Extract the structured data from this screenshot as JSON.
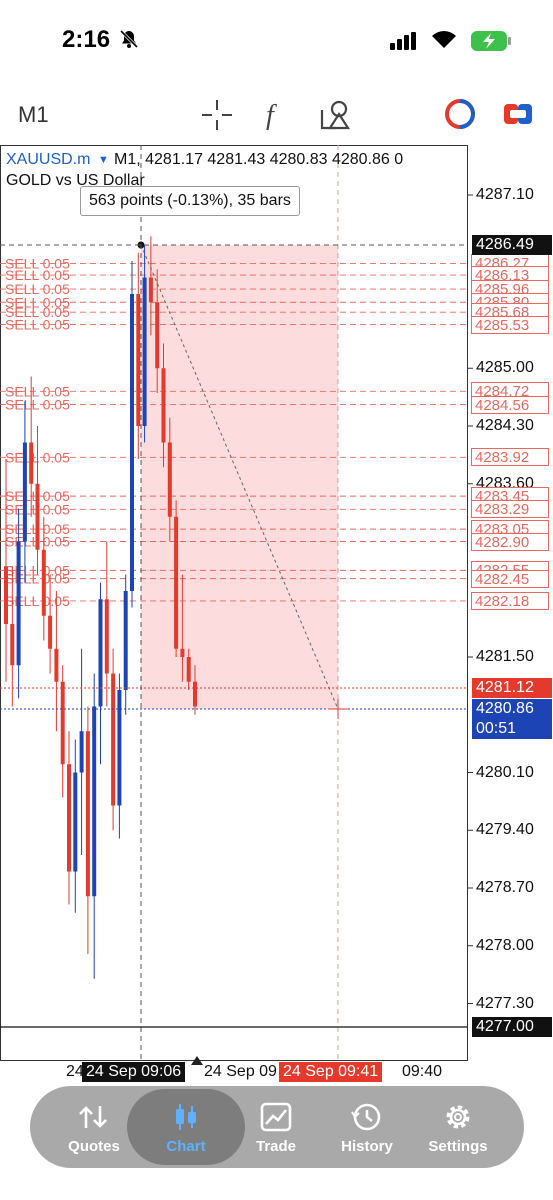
{
  "status_bar": {
    "time": "2:16"
  },
  "toolbar": {
    "timeframe": "M1"
  },
  "chart_header": {
    "symbol": "XAUUSD.m",
    "timeframe": "M1,",
    "ohlc": "4281.17 4281.43 4280.83 4280.86 0",
    "subtitle": "GOLD vs US Dollar",
    "measure_tooltip": "563 points (-0.13%), 35 bars"
  },
  "price_axis": {
    "ticks": [
      "4287.10",
      "4285.00",
      "4284.30",
      "4283.60",
      "4281.50",
      "4280.10",
      "4279.40",
      "4278.70",
      "4278.00",
      "4277.30"
    ],
    "ask_label": "4281.12",
    "bid_label": "4280.86",
    "countdown": "00:51",
    "cursor_label": "4286.49",
    "bottom_label": "4277.00"
  },
  "orders": {
    "label": "SELL 0.05",
    "prices": [
      "4286.27",
      "4286.13",
      "4285.96",
      "4285.80",
      "4285.68",
      "4285.53",
      "4284.72",
      "4284.56",
      "4283.92",
      "4283.45",
      "4283.29",
      "4283.05",
      "4282.90",
      "4282.55",
      "4282.45",
      "4282.18"
    ]
  },
  "time_axis": {
    "left_fragment": "24",
    "cursor_time": "24 Sep 09:06",
    "mid_label": "24 Sep 09",
    "end_time": "24 Sep 09:41",
    "right_label": "09:40"
  },
  "colors": {
    "bull": "#1c44b5",
    "bear": "#e53a2b",
    "accent": "#1e5fc9",
    "order": "#e8685f"
  },
  "nav": {
    "items": [
      {
        "label": "Quotes",
        "icon": "quotes-arrows-icon"
      },
      {
        "label": "Chart",
        "icon": "candlestick-icon",
        "active": true
      },
      {
        "label": "Trade",
        "icon": "trade-chart-icon"
      },
      {
        "label": "History",
        "icon": "history-clock-icon"
      },
      {
        "label": "Settings",
        "icon": "gear-icon"
      }
    ]
  }
}
